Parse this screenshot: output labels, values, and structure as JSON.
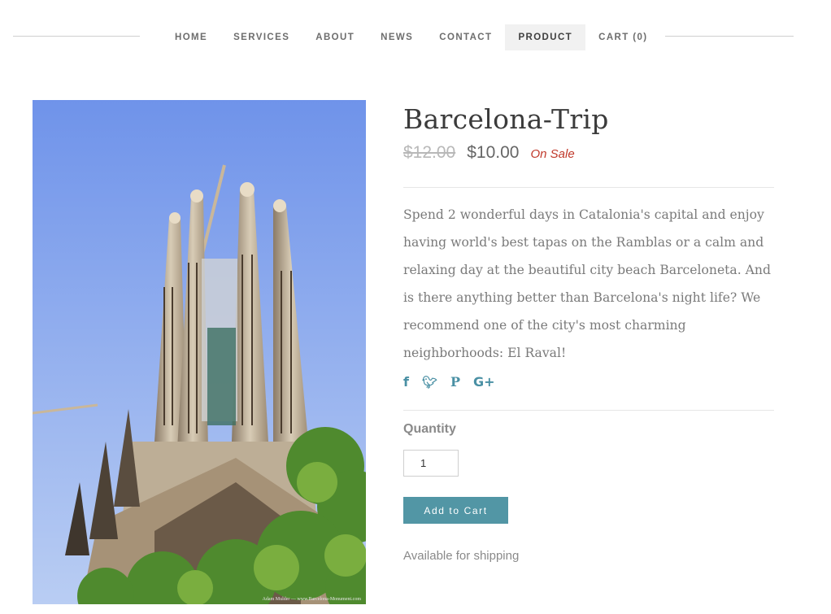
{
  "nav": {
    "items": [
      {
        "label": "HOME",
        "active": false
      },
      {
        "label": "SERVICES",
        "active": false
      },
      {
        "label": "ABOUT",
        "active": false
      },
      {
        "label": "NEWS",
        "active": false
      },
      {
        "label": "CONTACT",
        "active": false
      },
      {
        "label": "PRODUCT",
        "active": true
      },
      {
        "label": "CART (0)",
        "active": false
      }
    ]
  },
  "product": {
    "title": "Barcelona-Trip",
    "price_original": "$12.00",
    "price_sale": "$10.00",
    "sale_badge": "On Sale",
    "description": "Spend 2 wonderful days in Catalonia's capital and enjoy having world's best tapas on the Ramblas or a calm and relaxing day at the beautiful city beach Barceloneta. And is there anything better than Barcelona's night life? We recommend one of the city's most charming neighborhoods: El Raval!",
    "quantity_label": "Quantity",
    "quantity_value": "1",
    "add_to_cart_label": "Add to Cart",
    "availability": "Available for shipping"
  },
  "social": [
    {
      "icon": "facebook-icon",
      "glyph": "f"
    },
    {
      "icon": "twitter-icon",
      "glyph": "🐦"
    },
    {
      "icon": "pinterest-icon",
      "glyph": "P"
    },
    {
      "icon": "google-plus-icon",
      "glyph": "G+"
    }
  ],
  "image": {
    "subject": "Sagrada Familia basilica spires under blue sky with trees",
    "credit": "Adam Mulder — www.Barcelona-Monument.com"
  },
  "colors": {
    "accent": "#5296a5",
    "sale_red": "#c0392b",
    "nav_active_bg": "#f1f1f1"
  }
}
